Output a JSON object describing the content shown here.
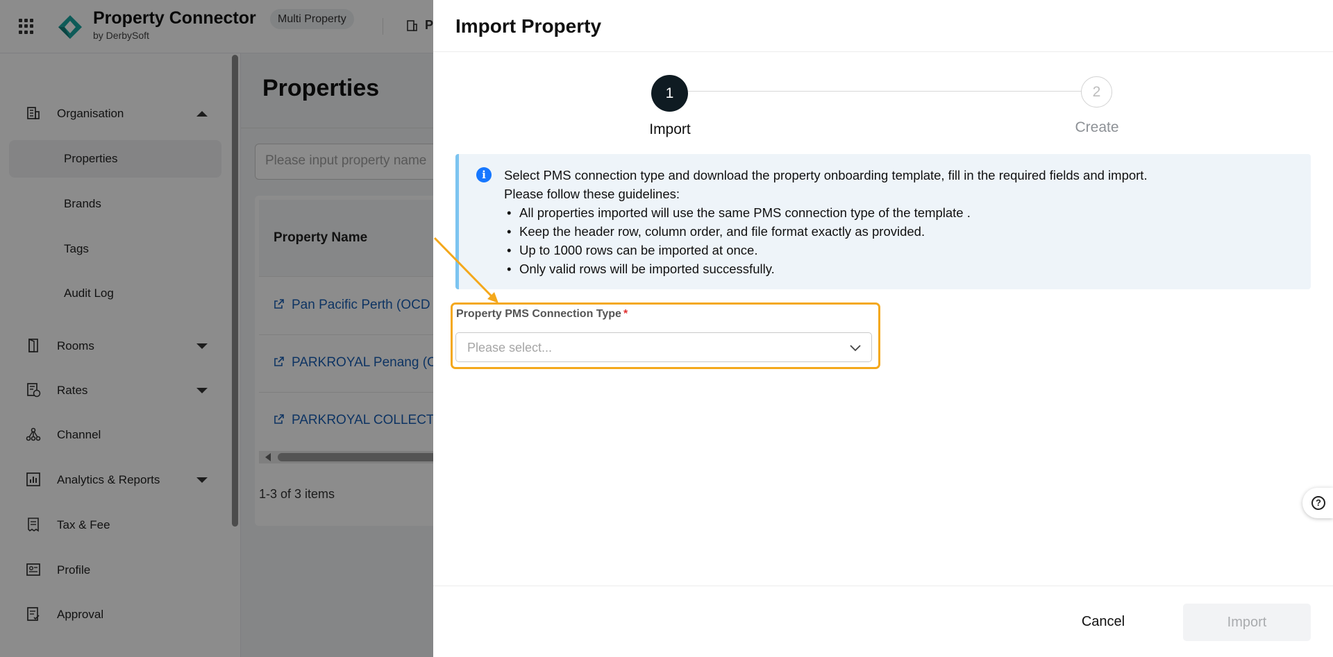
{
  "app": {
    "title": "Property Connector",
    "subtitle": "by DerbySoft",
    "mode_badge": "Multi Property",
    "topbar_truncated": "P"
  },
  "sidebar": {
    "items": [
      {
        "label": "Organisation",
        "icon": "building-icon",
        "expanded": true
      },
      {
        "label": "Properties",
        "active": true
      },
      {
        "label": "Brands"
      },
      {
        "label": "Tags"
      },
      {
        "label": "Audit Log"
      },
      {
        "label": "Rooms",
        "icon": "door-icon"
      },
      {
        "label": "Rates",
        "icon": "rates-icon"
      },
      {
        "label": "Channel",
        "icon": "channel-icon"
      },
      {
        "label": "Analytics & Reports",
        "icon": "chart-icon"
      },
      {
        "label": "Tax & Fee",
        "icon": "tax-icon"
      },
      {
        "label": "Profile",
        "icon": "profile-icon"
      },
      {
        "label": "Approval",
        "icon": "approval-icon"
      }
    ]
  },
  "main": {
    "page_title": "Properties",
    "search_placeholder": "Please input property name",
    "table": {
      "column_header": "Property Name",
      "rows": [
        "Pan Pacific Perth (OCD",
        "PARKROYAL Penang (C",
        "PARKROYAL COLLECT"
      ]
    },
    "pagination": "1-3 of 3 items"
  },
  "drawer": {
    "title": "Import Property",
    "steps": [
      {
        "number": "1",
        "label": "Import",
        "active": true
      },
      {
        "number": "2",
        "label": "Create",
        "active": false
      }
    ],
    "info": {
      "line1": "Select PMS connection type and download the property onboarding template, fill in the required fields and import.",
      "line2": "Please follow these guidelines:",
      "bullets": [
        "All properties imported will use the same PMS connection type of the template .",
        "Keep the header row, column order, and file format exactly as provided.",
        "Up to 1000 rows can be imported at once.",
        "Only valid rows will be imported successfully."
      ]
    },
    "field": {
      "label": "Property PMS Connection Type",
      "required_mark": "*",
      "placeholder": "Please select..."
    },
    "buttons": {
      "cancel": "Cancel",
      "import": "Import"
    }
  },
  "colors": {
    "highlight": "#f4a81c",
    "link": "#1a5fb4",
    "step_active": "#0f1b22",
    "info_accent": "#7cc4f0",
    "required": "#e03030"
  }
}
